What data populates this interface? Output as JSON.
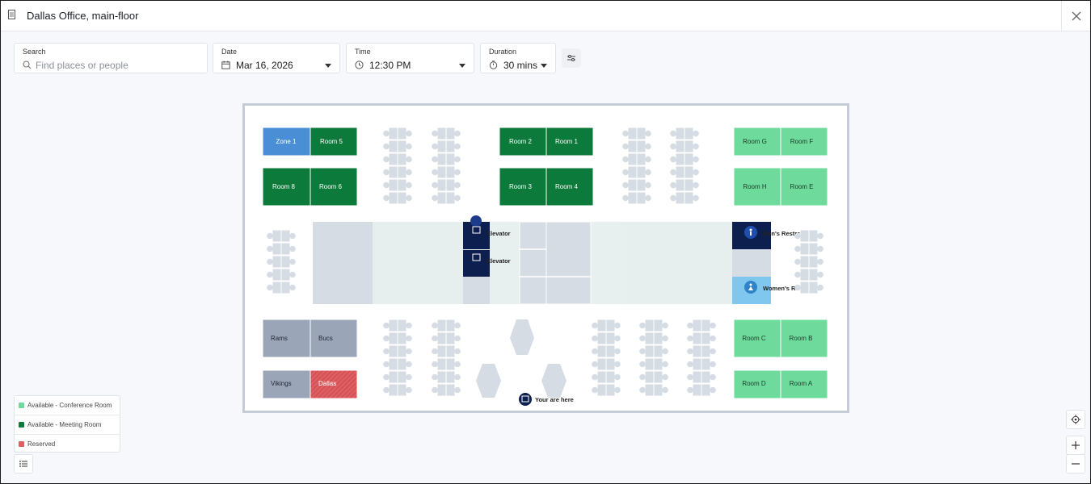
{
  "window": {
    "title": "Dallas Office, main-floor"
  },
  "filters": {
    "search": {
      "label": "Search",
      "placeholder": "Find places or people"
    },
    "date": {
      "label": "Date",
      "value": "Mar 16, 2026"
    },
    "time": {
      "label": "Time",
      "value": "12:30 PM"
    },
    "duration": {
      "label": "Duration",
      "value": "30 mins"
    }
  },
  "map": {
    "rooms": {
      "zone1": "Zone 1",
      "room5": "Room 5",
      "room8": "Room 8",
      "room6": "Room 6",
      "room2": "Room 2",
      "room1": "Room 1",
      "room3": "Room 3",
      "room4": "Room 4",
      "roomG": "Room G",
      "roomF": "Room F",
      "roomH": "Room H",
      "roomE": "Room E",
      "rams": "Rams",
      "bucs": "Bucs",
      "vikings": "Vikings",
      "dallas": "Dallas",
      "roomC": "Room C",
      "roomB": "Room B",
      "roomD": "Room D",
      "roomA": "Room A"
    },
    "poi": {
      "elevator1": "Elevator",
      "elevator2": "Elevator",
      "mens": "Men's Restroom",
      "womens": "Women's Restroom",
      "you_are_here": "Your are here"
    }
  },
  "legend": {
    "items": [
      {
        "label": "Available - Conference Room",
        "color": "#6edb9c"
      },
      {
        "label": "Available - Meeting Room",
        "color": "#0c7a3a"
      },
      {
        "label": "Reserved",
        "color": "#de5e62"
      }
    ]
  },
  "colors": {
    "conference": "#6edb9c",
    "meeting": "#0c7a3a",
    "reserved": "#de5e62",
    "zone": "#4a8fd6",
    "unavailable": "#9aa6b8",
    "navy": "#0d1f4e",
    "light_blue": "#7fc7ee"
  }
}
